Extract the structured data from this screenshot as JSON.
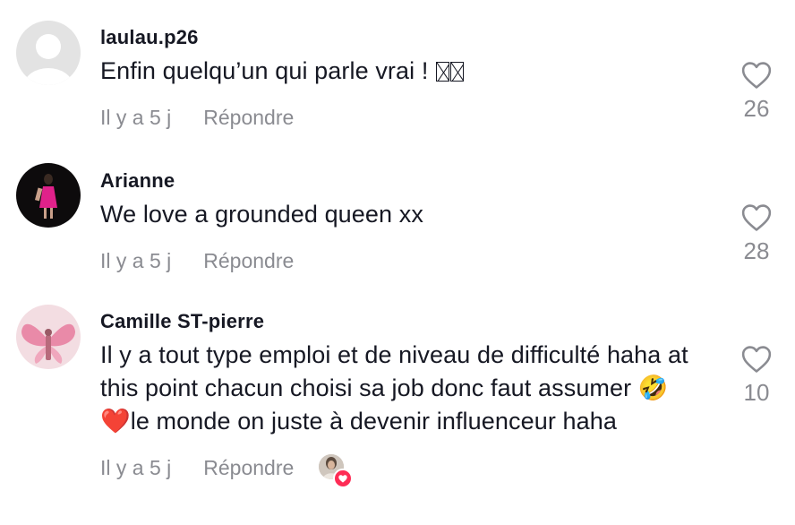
{
  "comments": [
    {
      "username": "laulau.p26",
      "text": "Enfin quelqu’un qui parle vrai ! ",
      "time": "Il y a 5 j",
      "reply_label": "Répondre",
      "likes": "26"
    },
    {
      "username": "Arianne",
      "text": "We love a grounded queen xx",
      "time": "Il y a 5 j",
      "reply_label": "Répondre",
      "likes": "28"
    },
    {
      "username": "Camille ST-pierre",
      "text_before_emoji": "Il y a tout type emploi et de niveau de difficulté haha at this point chacun choisi sa job donc faut assumer ",
      "emoji": "🤣❤️",
      "text_after_emoji": "le monde on juste à devenir influenceur haha",
      "time": "Il y a 5 j",
      "reply_label": "Répondre",
      "likes": "10",
      "liked_by_creator": true
    }
  ],
  "colors": {
    "primary_text": "#161823",
    "secondary_text": "#8a8b91",
    "accent_heart": "#fe2c55"
  },
  "icons": {
    "like": "heart-outline-icon",
    "creator_like_badge": "heart-icon"
  }
}
